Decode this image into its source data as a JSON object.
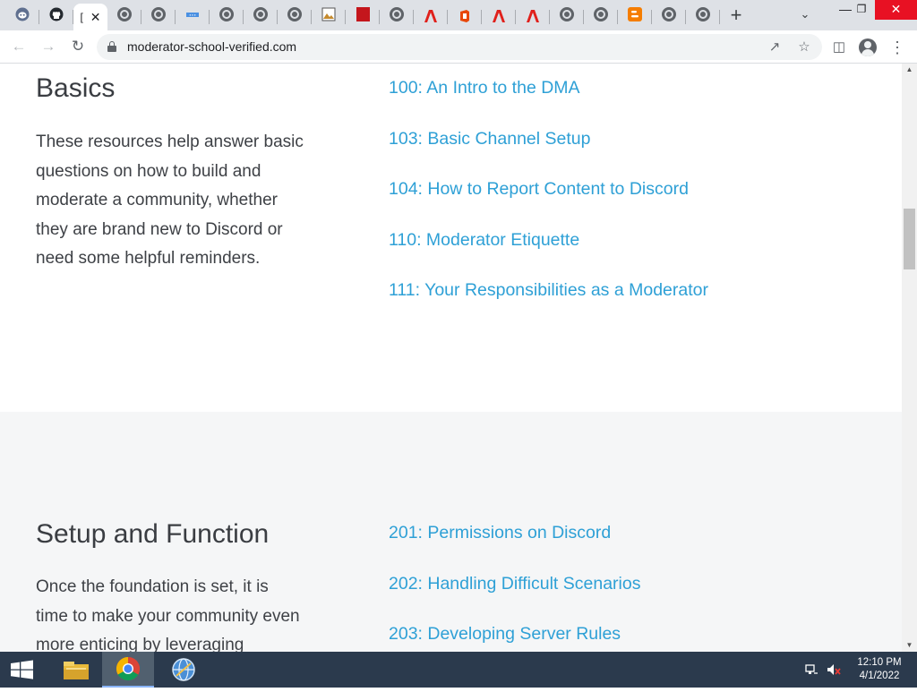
{
  "browser": {
    "tabs": [
      {
        "icon": "discord-icon"
      },
      {
        "icon": "github-icon"
      },
      {
        "icon": "page-icon",
        "active": true,
        "title": "["
      },
      {
        "icon": "globe-icon"
      },
      {
        "icon": "globe-icon"
      },
      {
        "icon": "blue-site-icon"
      },
      {
        "icon": "globe-icon"
      },
      {
        "icon": "globe-icon"
      },
      {
        "icon": "globe-icon"
      },
      {
        "icon": "image-icon"
      },
      {
        "icon": "pdf-icon"
      },
      {
        "icon": "globe-icon"
      },
      {
        "icon": "adobe-icon"
      },
      {
        "icon": "office-icon"
      },
      {
        "icon": "adobe-icon"
      },
      {
        "icon": "adobe-icon"
      },
      {
        "icon": "globe-icon"
      },
      {
        "icon": "globe-icon"
      },
      {
        "icon": "blogger-icon"
      },
      {
        "icon": "globe-icon"
      },
      {
        "icon": "globe-icon"
      }
    ],
    "new_tab_label": "+",
    "address": "moderator-school-verified.com"
  },
  "page": {
    "basics": {
      "heading": "Basics",
      "description": "These resources help answer basic questions on how to build and moderate a community, whether they are brand new to Discord or need some helpful reminders.",
      "links": [
        "100: An Intro to the DMA",
        "103: Basic Channel Setup",
        "104: How to Report Content to Discord",
        "110: Moderator Etiquette",
        "111: Your Responsibilities as a Moderator"
      ]
    },
    "setup": {
      "heading": "Setup and Function",
      "description": "Once the foundation is set, it is time to make your community even more enticing by leveraging",
      "links": [
        "201: Permissions on Discord",
        "202: Handling Difficult Scenarios",
        "203: Developing Server Rules"
      ]
    }
  },
  "taskbar": {
    "apps": [
      "file-explorer-icon",
      "chrome-icon",
      "network-globe-icon"
    ],
    "clock_time": "12:10 PM",
    "clock_date": "4/1/2022"
  },
  "colors": {
    "link": "#2ea0d6",
    "heading": "#3a3d42",
    "grey_section": "#f5f6f7",
    "taskbar": "#2b3a4d"
  }
}
